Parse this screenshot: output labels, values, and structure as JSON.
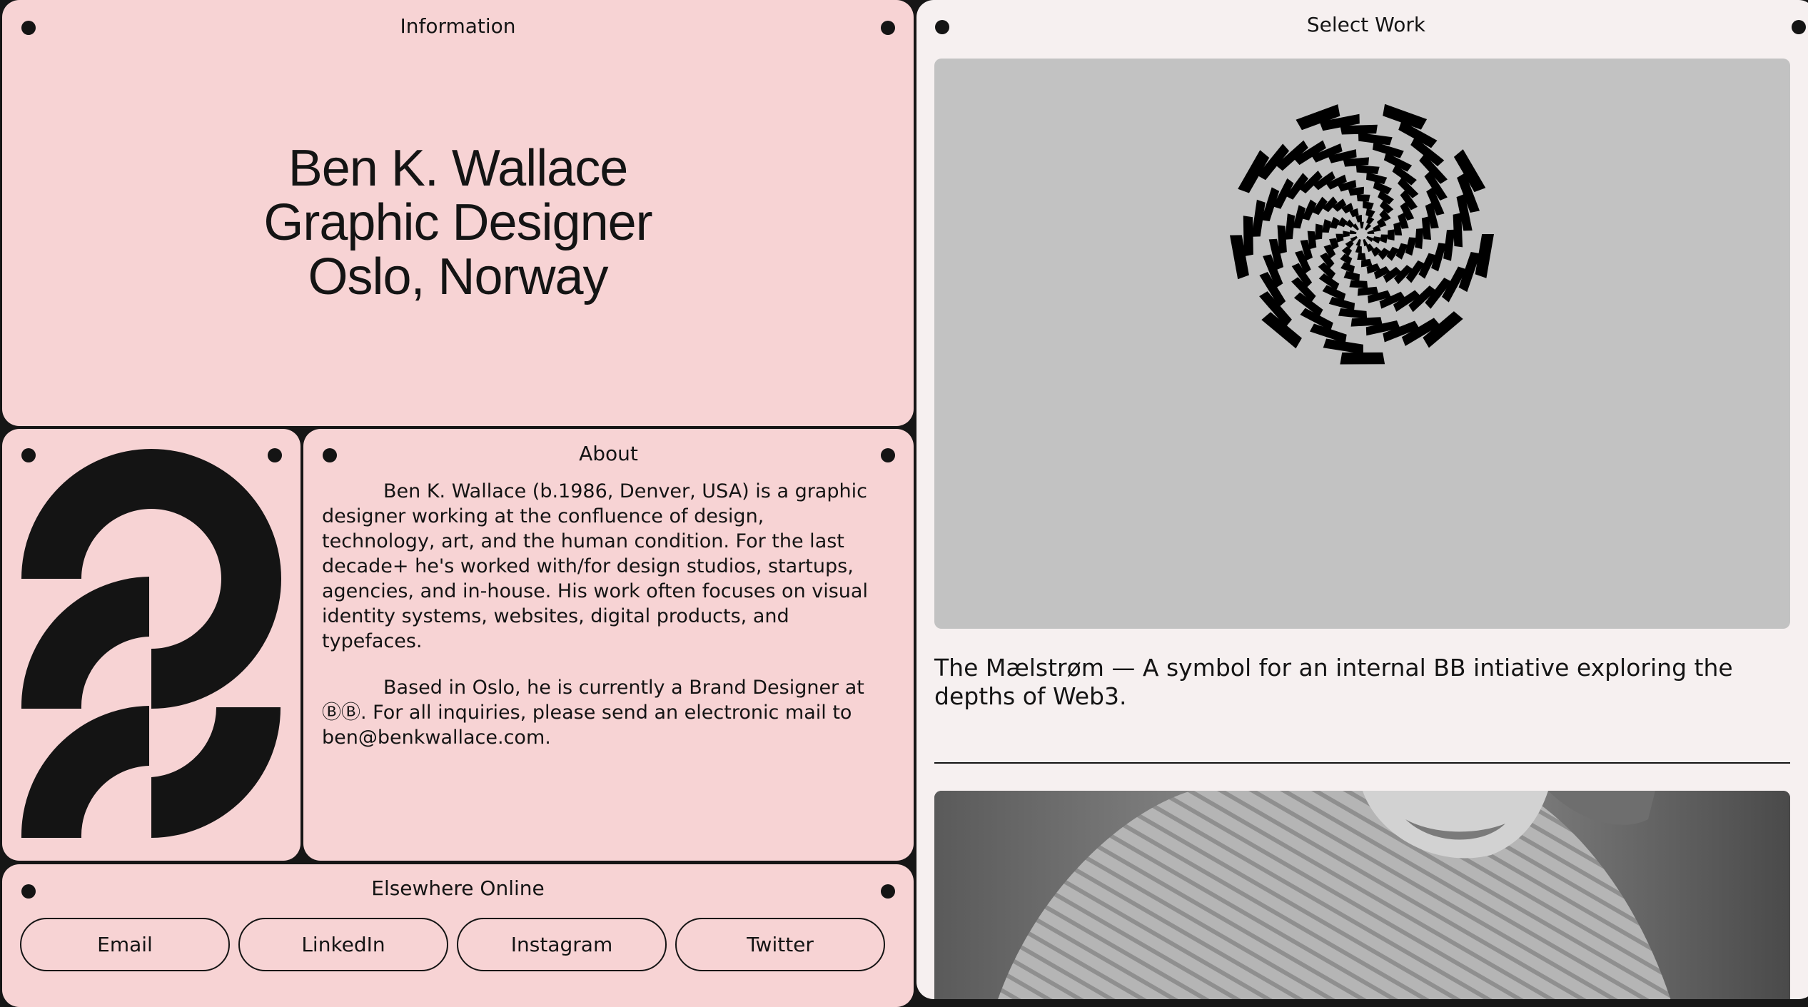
{
  "information": {
    "title": "Information",
    "lines": [
      "Ben K. Wallace",
      "Graphic Designer",
      "Oslo, Norway"
    ]
  },
  "about": {
    "title": "About",
    "paragraphs": [
      "Ben K. Wallace (b.1986, Denver, USA) is a graphic designer working at the confluence of design, technology, art, and the human condition. For the last decade+ he's worked with/for design studios, startups, agencies, and in-house. His work often focuses on visual identity systems, websites, digital products, and typefaces.",
      "Based in Oslo, he is currently a Brand Designer at ⒷⒷ. For all inquiries, please send an electronic mail to ben@benkwallace.com."
    ]
  },
  "elsewhere": {
    "title": "Elsewhere Online",
    "links": [
      "Email",
      "LinkedIn",
      "Instagram",
      "Twitter"
    ]
  },
  "work": {
    "title": "Select Work",
    "items": [
      {
        "caption": "The Mælstrøm — A symbol for an internal BB intiative exploring the depths of Web3."
      }
    ]
  },
  "colors": {
    "panel_pink": "#f7d3d4",
    "panel_light": "#f6f0f0",
    "background": "#161616",
    "ink": "#141414",
    "artwork_gray": "#c2c2c2"
  },
  "icons": [
    "corner-dot-icon",
    "bb-monogram-logo",
    "maelstrom-spiral-artwork"
  ]
}
